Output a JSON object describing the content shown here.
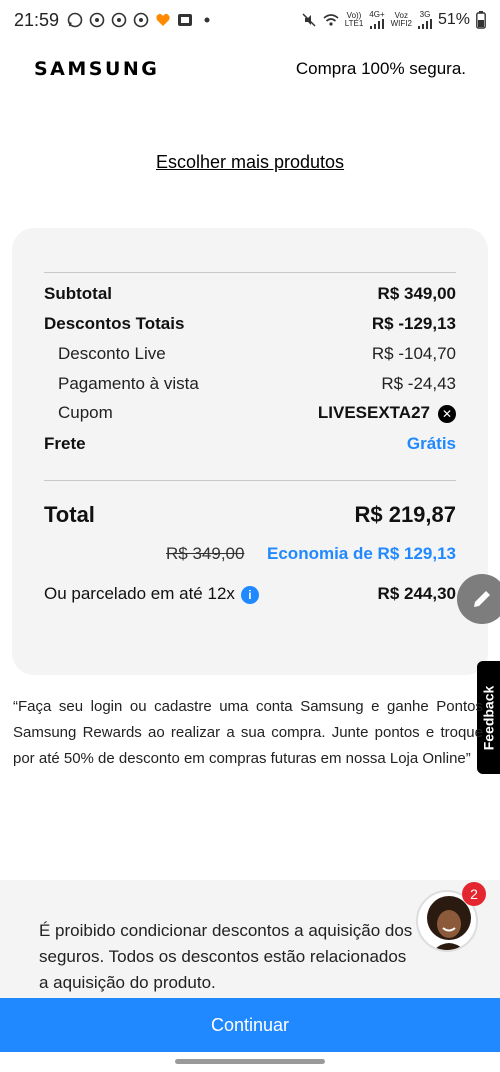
{
  "status_bar": {
    "time": "21:59",
    "net1_top": "Vo))",
    "net1_bottom": "LTE1",
    "net1_gen": "4G+",
    "net2_top": "Voz",
    "net2_bottom": "WIFI2",
    "net2_gen": "3G",
    "battery": "51%"
  },
  "header": {
    "logo": "SAMSUNG",
    "secure_text": "Compra 100% segura."
  },
  "more_products_link": "Escolher mais produtos",
  "summary": {
    "subtotal_label": "Subtotal",
    "subtotal_value": "R$ 349,00",
    "discounts_label": "Descontos Totais",
    "discounts_value": "R$ -129,13",
    "live_label": "Desconto Live",
    "live_value": "R$ -104,70",
    "cash_label": "Pagamento à vista",
    "cash_value": "R$ -24,43",
    "coupon_label": "Cupom",
    "coupon_value": "LIVESEXTA27",
    "shipping_label": "Frete",
    "shipping_value": "Grátis",
    "total_label": "Total",
    "total_value": "R$ 219,87",
    "original_price": "R$ 349,00",
    "savings": "Economia de R$ 129,13",
    "installment_label": "Ou parcelado em até 12x",
    "installment_value": "R$ 244,30"
  },
  "feedback_label": "Feedback",
  "promo_text": "“Faça seu login ou cadastre uma conta Samsung e ganhe Pontos Samsung Rewards ao realizar a sua compra. Junte pontos e troque por até 50% de desconto em compras futuras em nossa Loja Online”",
  "disclaimer": "É proibido condicionar descontos a aquisição dos seguros. Todos os descontos estão relacionados a aquisição do produto.",
  "chat_badge": "2",
  "continue_label": "Continuar",
  "colors": {
    "accent": "#2189ff",
    "badge": "#e3262f",
    "card_bg": "#f4f4f4"
  }
}
